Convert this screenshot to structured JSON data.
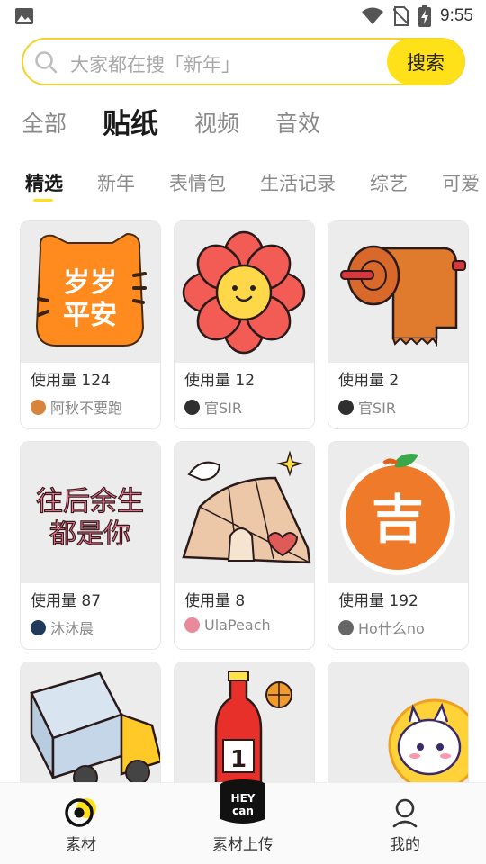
{
  "status_bar": {
    "time": "9:55"
  },
  "search": {
    "placeholder": "大家都在搜「新年」",
    "button_label": "搜索"
  },
  "categories": [
    {
      "label": "全部",
      "active": false
    },
    {
      "label": "贴纸",
      "active": true
    },
    {
      "label": "视频",
      "active": false
    },
    {
      "label": "音效",
      "active": false
    }
  ],
  "subtabs": [
    {
      "label": "精选",
      "active": true
    },
    {
      "label": "新年",
      "active": false
    },
    {
      "label": "表情包",
      "active": false
    },
    {
      "label": "生活记录",
      "active": false
    },
    {
      "label": "综艺",
      "active": false
    },
    {
      "label": "可爱",
      "active": false
    }
  ],
  "cards": [
    {
      "usage": "使用量 124",
      "author": "阿秋不要跑",
      "sticker_text": "岁岁平安",
      "icon": "tiger-sticker",
      "avatar_color": "#d8843c"
    },
    {
      "usage": "使用量 12",
      "author": "官SIR",
      "icon": "flower-sticker",
      "avatar_color": "#2f2f2f"
    },
    {
      "usage": "使用量 2",
      "author": "官SIR",
      "icon": "toilet-roll-sticker",
      "avatar_color": "#2f2f2f"
    },
    {
      "usage": "使用量 87",
      "author": "沐沐晨",
      "sticker_text": "往后余生 都是你",
      "icon": "text-sticker",
      "avatar_color": "#1f3a5a"
    },
    {
      "usage": "使用量 8",
      "author": "UlaPeach",
      "icon": "tent-sticker",
      "avatar_color": "#e98a9a"
    },
    {
      "usage": "使用量 192",
      "author": "Ho什么no",
      "sticker_text": "吉",
      "icon": "orange-sticker",
      "avatar_color": "#666666"
    },
    {
      "icon": "truck-sticker"
    },
    {
      "icon": "bottle-sticker"
    },
    {
      "icon": "lion-sticker"
    }
  ],
  "bottom_nav": [
    {
      "label": "素材",
      "icon": "material-icon",
      "active": true
    },
    {
      "label": "素材上传",
      "icon": "heycan-upload-icon",
      "logo_text": "HEY can",
      "active": false
    },
    {
      "label": "我的",
      "icon": "profile-icon",
      "active": false
    }
  ]
}
